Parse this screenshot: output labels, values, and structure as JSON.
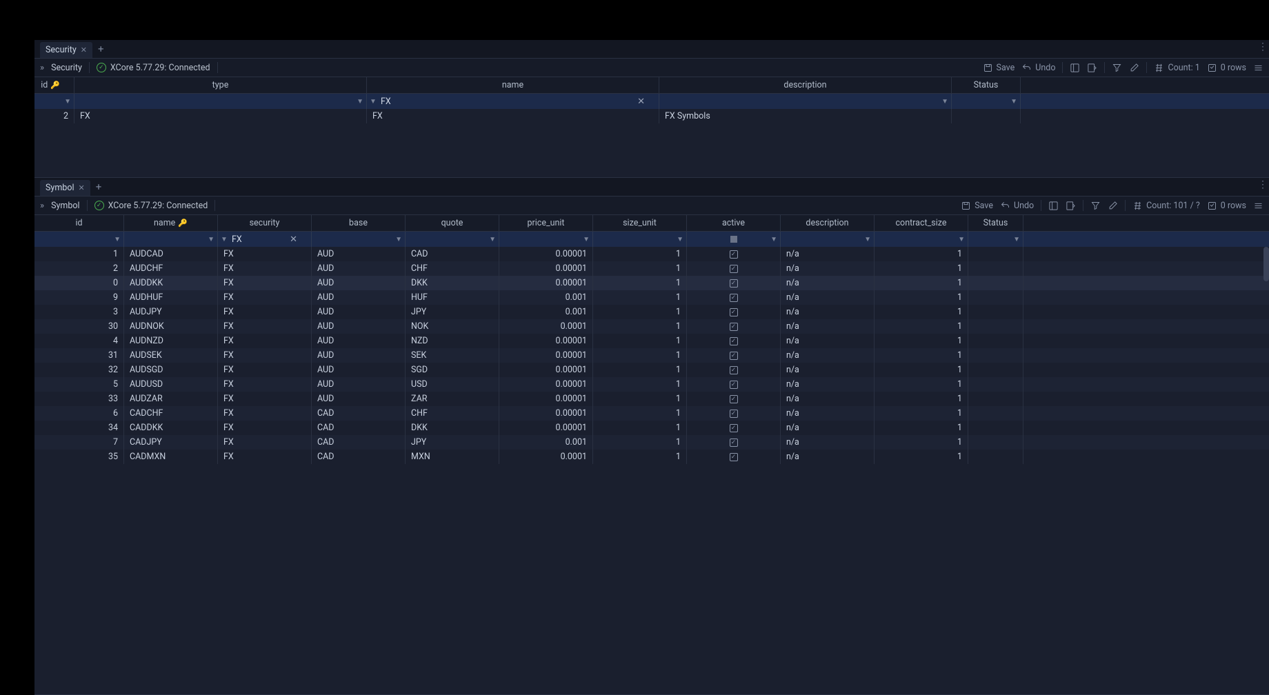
{
  "top": {
    "tab": "Security",
    "breadcrumb": "Security",
    "connection": "XCore 5.77.29: Connected",
    "toolbar": {
      "save": "Save",
      "undo": "Undo",
      "count": "Count: 1",
      "rows": "0 rows"
    },
    "columns": [
      "id",
      "type",
      "name",
      "description",
      "Status"
    ],
    "filter": {
      "name": "FX"
    },
    "rows": [
      {
        "id": "2",
        "type": "FX",
        "name": "FX",
        "description": "FX Symbols"
      }
    ]
  },
  "bottom": {
    "tab": "Symbol",
    "breadcrumb": "Symbol",
    "connection": "XCore 5.77.29: Connected",
    "toolbar": {
      "save": "Save",
      "undo": "Undo",
      "count": "Count: 101 / ?",
      "rows": "0 rows"
    },
    "columns": [
      "id",
      "name",
      "security",
      "base",
      "quote",
      "price_unit",
      "size_unit",
      "active",
      "description",
      "contract_size",
      "Status"
    ],
    "filter": {
      "security": "FX"
    },
    "rows": [
      {
        "id": "1",
        "name": "AUDCAD",
        "security": "FX",
        "base": "AUD",
        "quote": "CAD",
        "price_unit": "0.00001",
        "size_unit": "1",
        "active": true,
        "description": "n/a",
        "contract_size": "1"
      },
      {
        "id": "2",
        "name": "AUDCHF",
        "security": "FX",
        "base": "AUD",
        "quote": "CHF",
        "price_unit": "0.00001",
        "size_unit": "1",
        "active": true,
        "description": "n/a",
        "contract_size": "1"
      },
      {
        "id": "0",
        "name": "AUDDKK",
        "security": "FX",
        "base": "AUD",
        "quote": "DKK",
        "price_unit": "0.00001",
        "size_unit": "1",
        "active": true,
        "description": "n/a",
        "contract_size": "1",
        "hl": true
      },
      {
        "id": "9",
        "name": "AUDHUF",
        "security": "FX",
        "base": "AUD",
        "quote": "HUF",
        "price_unit": "0.001",
        "size_unit": "1",
        "active": true,
        "description": "n/a",
        "contract_size": "1"
      },
      {
        "id": "3",
        "name": "AUDJPY",
        "security": "FX",
        "base": "AUD",
        "quote": "JPY",
        "price_unit": "0.001",
        "size_unit": "1",
        "active": true,
        "description": "n/a",
        "contract_size": "1"
      },
      {
        "id": "30",
        "name": "AUDNOK",
        "security": "FX",
        "base": "AUD",
        "quote": "NOK",
        "price_unit": "0.0001",
        "size_unit": "1",
        "active": true,
        "description": "n/a",
        "contract_size": "1"
      },
      {
        "id": "4",
        "name": "AUDNZD",
        "security": "FX",
        "base": "AUD",
        "quote": "NZD",
        "price_unit": "0.00001",
        "size_unit": "1",
        "active": true,
        "description": "n/a",
        "contract_size": "1"
      },
      {
        "id": "31",
        "name": "AUDSEK",
        "security": "FX",
        "base": "AUD",
        "quote": "SEK",
        "price_unit": "0.00001",
        "size_unit": "1",
        "active": true,
        "description": "n/a",
        "contract_size": "1"
      },
      {
        "id": "32",
        "name": "AUDSGD",
        "security": "FX",
        "base": "AUD",
        "quote": "SGD",
        "price_unit": "0.00001",
        "size_unit": "1",
        "active": true,
        "description": "n/a",
        "contract_size": "1"
      },
      {
        "id": "5",
        "name": "AUDUSD",
        "security": "FX",
        "base": "AUD",
        "quote": "USD",
        "price_unit": "0.00001",
        "size_unit": "1",
        "active": true,
        "description": "n/a",
        "contract_size": "1"
      },
      {
        "id": "33",
        "name": "AUDZAR",
        "security": "FX",
        "base": "AUD",
        "quote": "ZAR",
        "price_unit": "0.00001",
        "size_unit": "1",
        "active": true,
        "description": "n/a",
        "contract_size": "1"
      },
      {
        "id": "6",
        "name": "CADCHF",
        "security": "FX",
        "base": "CAD",
        "quote": "CHF",
        "price_unit": "0.00001",
        "size_unit": "1",
        "active": true,
        "description": "n/a",
        "contract_size": "1"
      },
      {
        "id": "34",
        "name": "CADDKK",
        "security": "FX",
        "base": "CAD",
        "quote": "DKK",
        "price_unit": "0.00001",
        "size_unit": "1",
        "active": true,
        "description": "n/a",
        "contract_size": "1"
      },
      {
        "id": "7",
        "name": "CADJPY",
        "security": "FX",
        "base": "CAD",
        "quote": "JPY",
        "price_unit": "0.001",
        "size_unit": "1",
        "active": true,
        "description": "n/a",
        "contract_size": "1"
      },
      {
        "id": "35",
        "name": "CADMXN",
        "security": "FX",
        "base": "CAD",
        "quote": "MXN",
        "price_unit": "0.0001",
        "size_unit": "1",
        "active": true,
        "description": "n/a",
        "contract_size": "1"
      }
    ]
  }
}
